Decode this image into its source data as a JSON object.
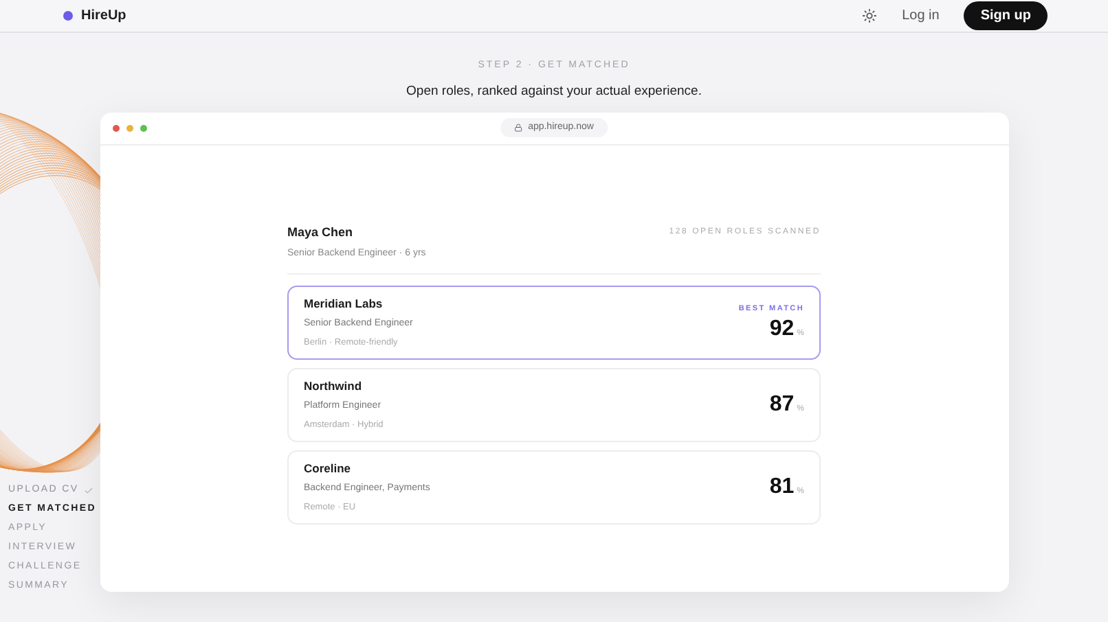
{
  "header": {
    "brand": "HireUp",
    "login": "Log in",
    "signup": "Sign up"
  },
  "steps": [
    {
      "label": "UPLOAD CV",
      "done": true,
      "selected": false
    },
    {
      "label": "GET MATCHED",
      "done": false,
      "selected": true
    },
    {
      "label": "APPLY",
      "done": false,
      "selected": false
    },
    {
      "label": "INTERVIEW",
      "done": false,
      "selected": false
    },
    {
      "label": "CHALLENGE",
      "done": false,
      "selected": false
    },
    {
      "label": "SUMMARY",
      "done": false,
      "selected": false
    }
  ],
  "eyebrow": "STEP 2 · GET MATCHED",
  "headline": "Open roles, ranked against your actual experience.",
  "browser": {
    "url": "app.hireup.now"
  },
  "candidate": {
    "name": "Maya Chen",
    "title": "Senior Backend Engineer · 6 yrs",
    "scanned": "128 OPEN ROLES SCANNED"
  },
  "matches": [
    {
      "company": "Meridian Labs",
      "role": "Senior Backend Engineer",
      "location": "Berlin · Remote-friendly",
      "score": "92",
      "unit": "%",
      "badge": "BEST MATCH",
      "selected": true
    },
    {
      "company": "Northwind",
      "role": "Platform Engineer",
      "location": "Amsterdam · Hybrid",
      "score": "87",
      "unit": "%",
      "selected": false
    },
    {
      "company": "Coreline",
      "role": "Backend Engineer, Payments",
      "location": "Remote · EU",
      "score": "81",
      "unit": "%",
      "selected": false
    }
  ]
}
